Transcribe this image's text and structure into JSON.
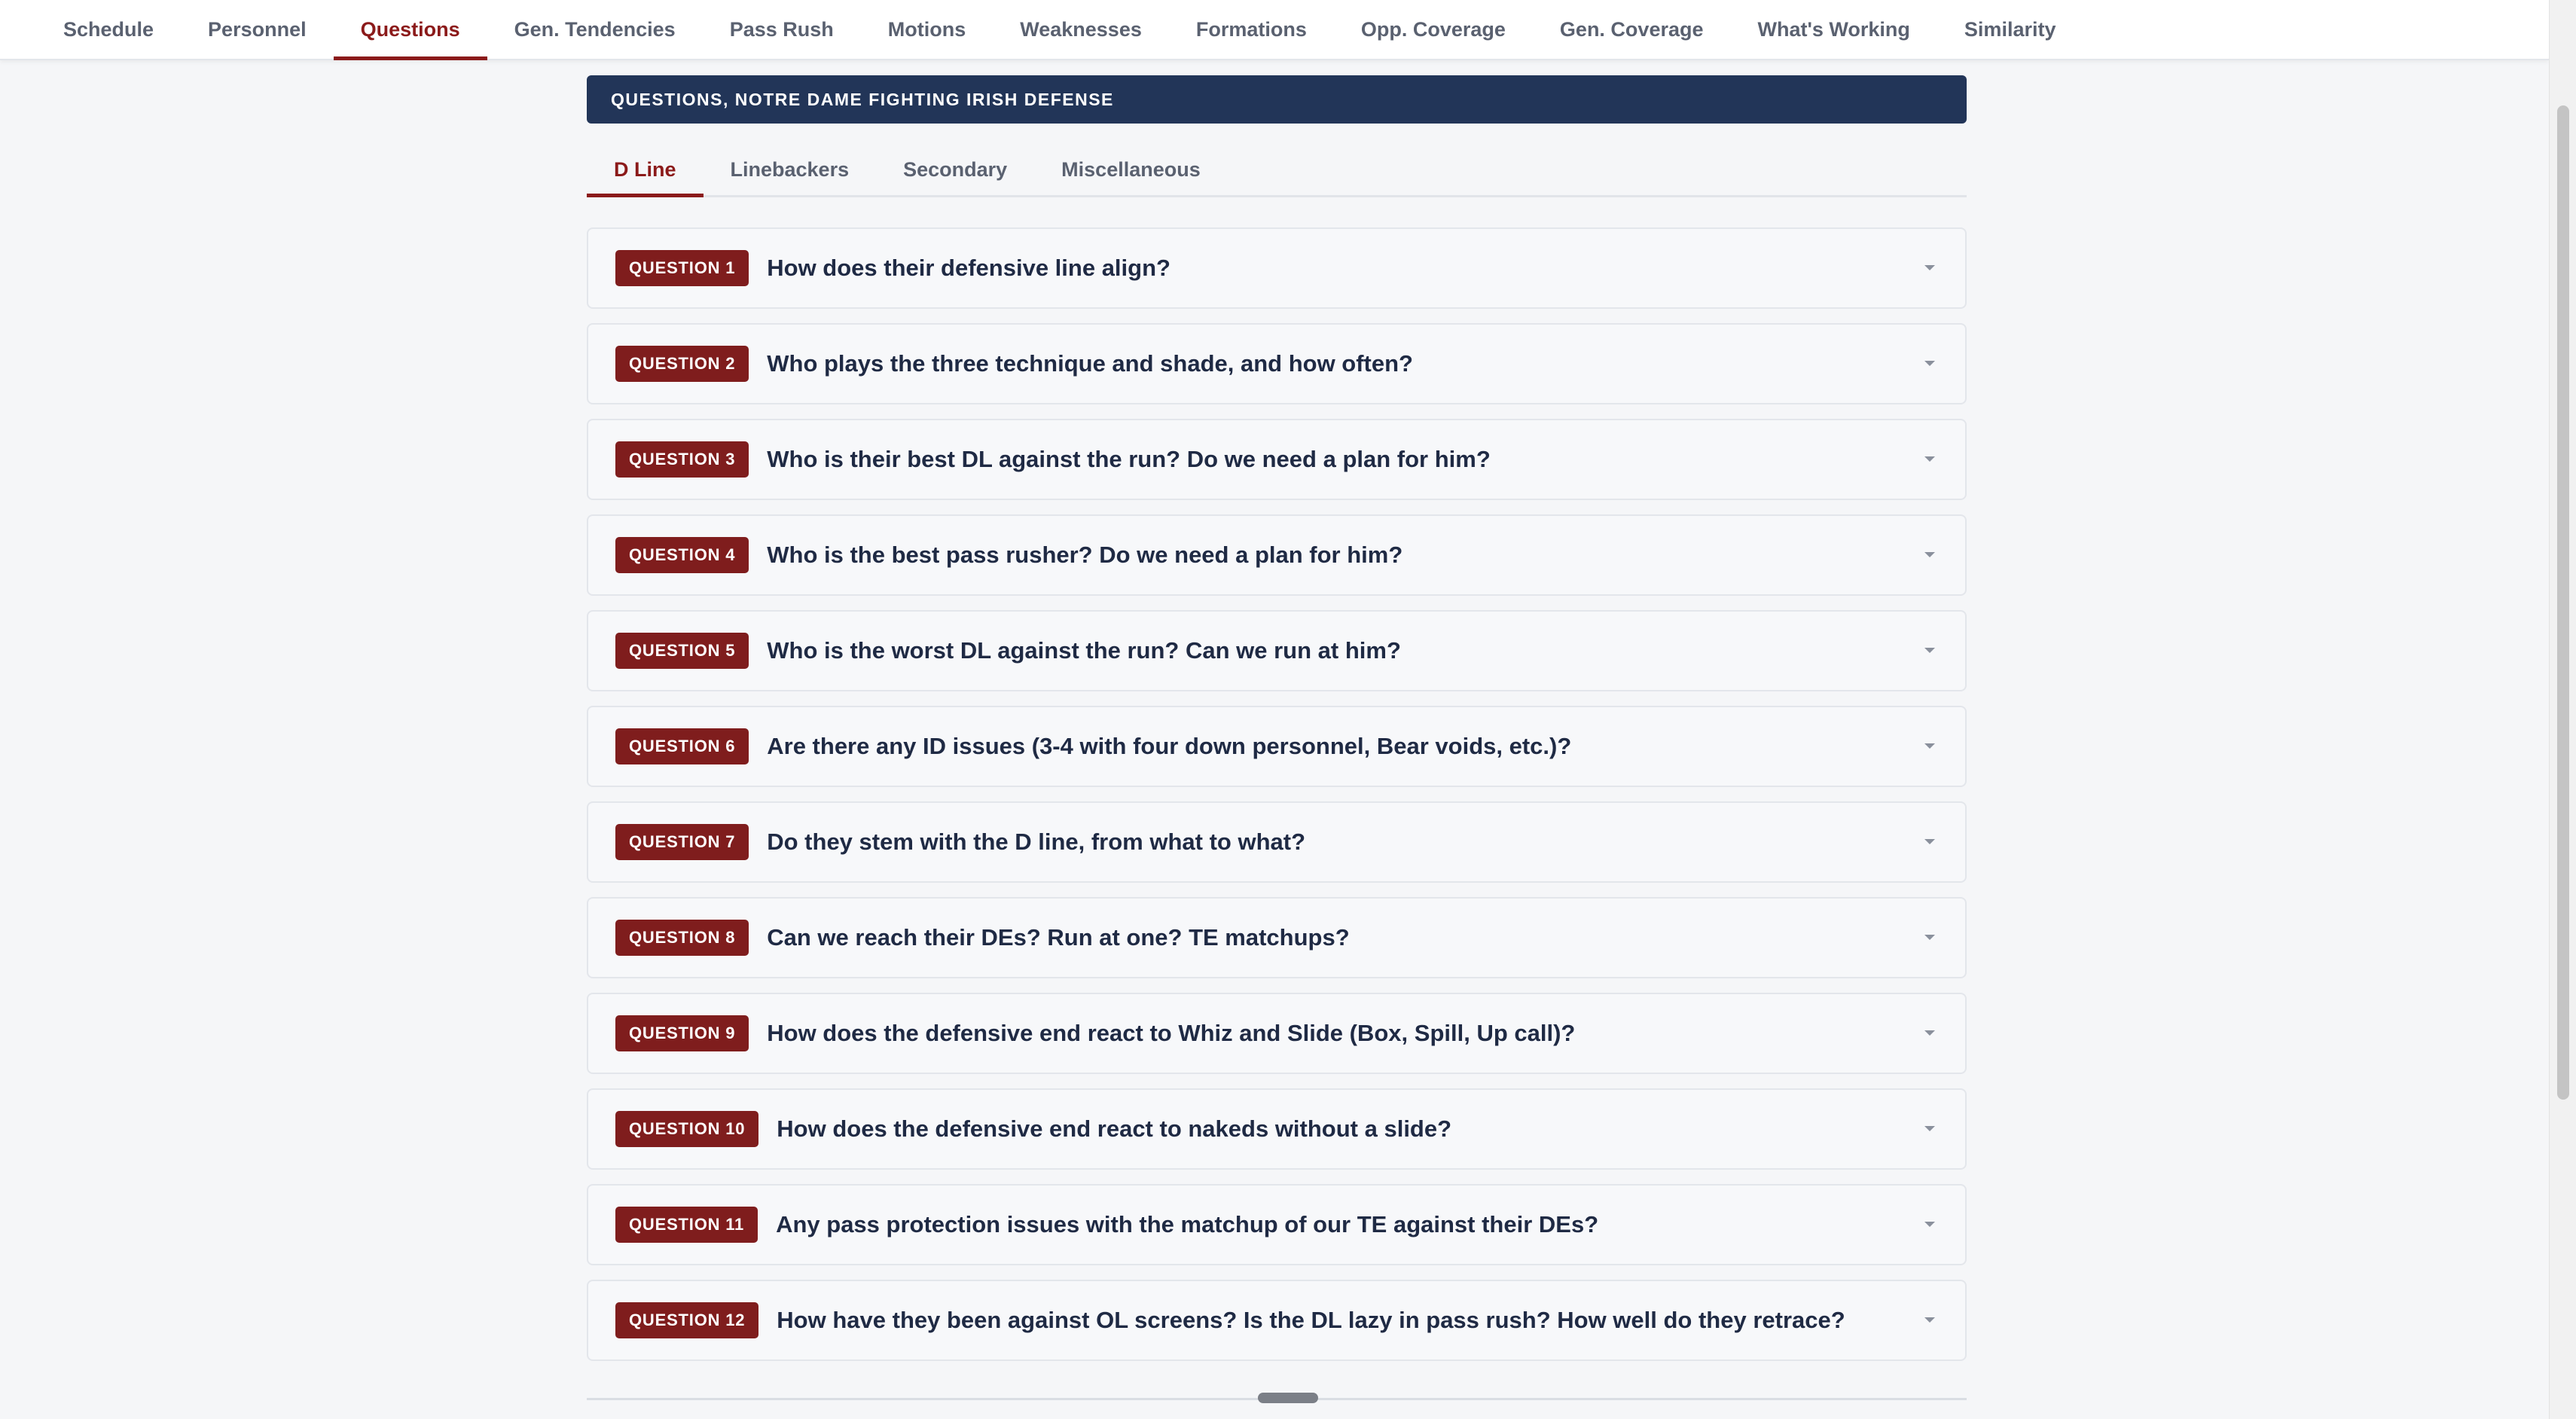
{
  "nav": {
    "items": [
      {
        "label": "Schedule",
        "active": false
      },
      {
        "label": "Personnel",
        "active": false
      },
      {
        "label": "Questions",
        "active": true
      },
      {
        "label": "Gen. Tendencies",
        "active": false
      },
      {
        "label": "Pass Rush",
        "active": false
      },
      {
        "label": "Motions",
        "active": false
      },
      {
        "label": "Weaknesses",
        "active": false
      },
      {
        "label": "Formations",
        "active": false
      },
      {
        "label": "Opp. Coverage",
        "active": false
      },
      {
        "label": "Gen. Coverage",
        "active": false
      },
      {
        "label": "What's Working",
        "active": false
      },
      {
        "label": "Similarity",
        "active": false
      }
    ]
  },
  "section": {
    "title": "QUESTIONS, NOTRE DAME FIGHTING IRISH DEFENSE"
  },
  "subtabs": [
    {
      "label": "D Line",
      "active": true
    },
    {
      "label": "Linebackers",
      "active": false
    },
    {
      "label": "Secondary",
      "active": false
    },
    {
      "label": "Miscellaneous",
      "active": false
    }
  ],
  "questions": [
    {
      "badge": "QUESTION 1",
      "text": "How does their defensive line align?"
    },
    {
      "badge": "QUESTION 2",
      "text": "Who plays the three technique and shade, and how often?"
    },
    {
      "badge": "QUESTION 3",
      "text": "Who is their best DL against the run? Do we need a plan for him?"
    },
    {
      "badge": "QUESTION 4",
      "text": "Who is the best pass rusher? Do we need a plan for him?"
    },
    {
      "badge": "QUESTION 5",
      "text": "Who is the worst DL against the run? Can we run at him?"
    },
    {
      "badge": "QUESTION 6",
      "text": "Are there any ID issues (3-4 with four down personnel, Bear voids, etc.)?"
    },
    {
      "badge": "QUESTION 7",
      "text": "Do they stem with the D line, from what to what?"
    },
    {
      "badge": "QUESTION 8",
      "text": "Can we reach their DEs? Run at one? TE matchups?"
    },
    {
      "badge": "QUESTION 9",
      "text": "How does the defensive end react to Whiz and Slide (Box, Spill, Up call)?"
    },
    {
      "badge": "QUESTION 10",
      "text": "How does the defensive end react to nakeds without a slide?"
    },
    {
      "badge": "QUESTION 11",
      "text": "Any pass protection issues with the matchup of our TE against their DEs?"
    },
    {
      "badge": "QUESTION 12",
      "text": "How have they been against OL screens? Is the DL lazy in pass rush? How well do they retrace?"
    }
  ],
  "icons": {
    "expand": "chevron-down-icon"
  },
  "colors": {
    "accent": "#8b1a1a",
    "badge": "#7f1d1d",
    "header": "#223558"
  }
}
